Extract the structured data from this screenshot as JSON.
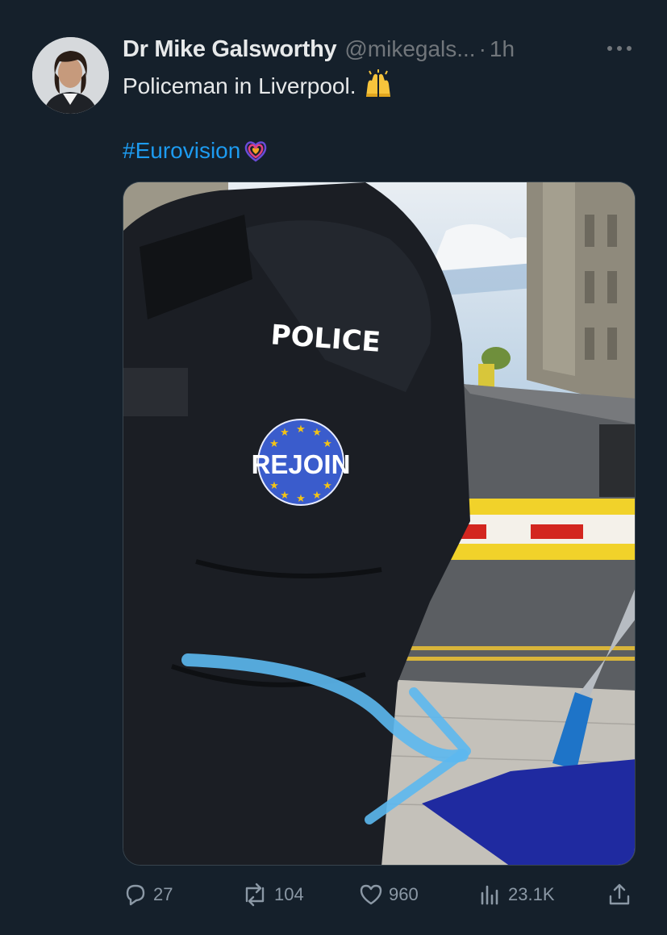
{
  "author": {
    "name": "Dr Mike Galsworthy",
    "handle": "@mikegals...",
    "separator": "·",
    "time": "1h"
  },
  "tweet": {
    "text": "Policeman in Liverpool.",
    "emoji_icon": "raising-hands-icon",
    "hashtag": "#Eurovision",
    "hashtag_icon": "eurovision-heart-icon"
  },
  "photo": {
    "jacket_label": "POLICE",
    "badge_text": "REJOIN",
    "colors": {
      "jacket": "#1b1e24",
      "badge": "#3a5ccc",
      "stars": "#f3c316",
      "arrow": "#5cb8ef",
      "flag": "#1f2aa0"
    }
  },
  "metrics": {
    "replies": "27",
    "reposts": "104",
    "likes": "960",
    "views": "23.1K"
  },
  "icons": [
    "reply-icon",
    "repost-icon",
    "like-icon",
    "views-icon",
    "share-icon",
    "more-icon"
  ],
  "colors": {
    "background": "#15202b",
    "link": "#1d9bf0",
    "muted": "#71767b"
  }
}
